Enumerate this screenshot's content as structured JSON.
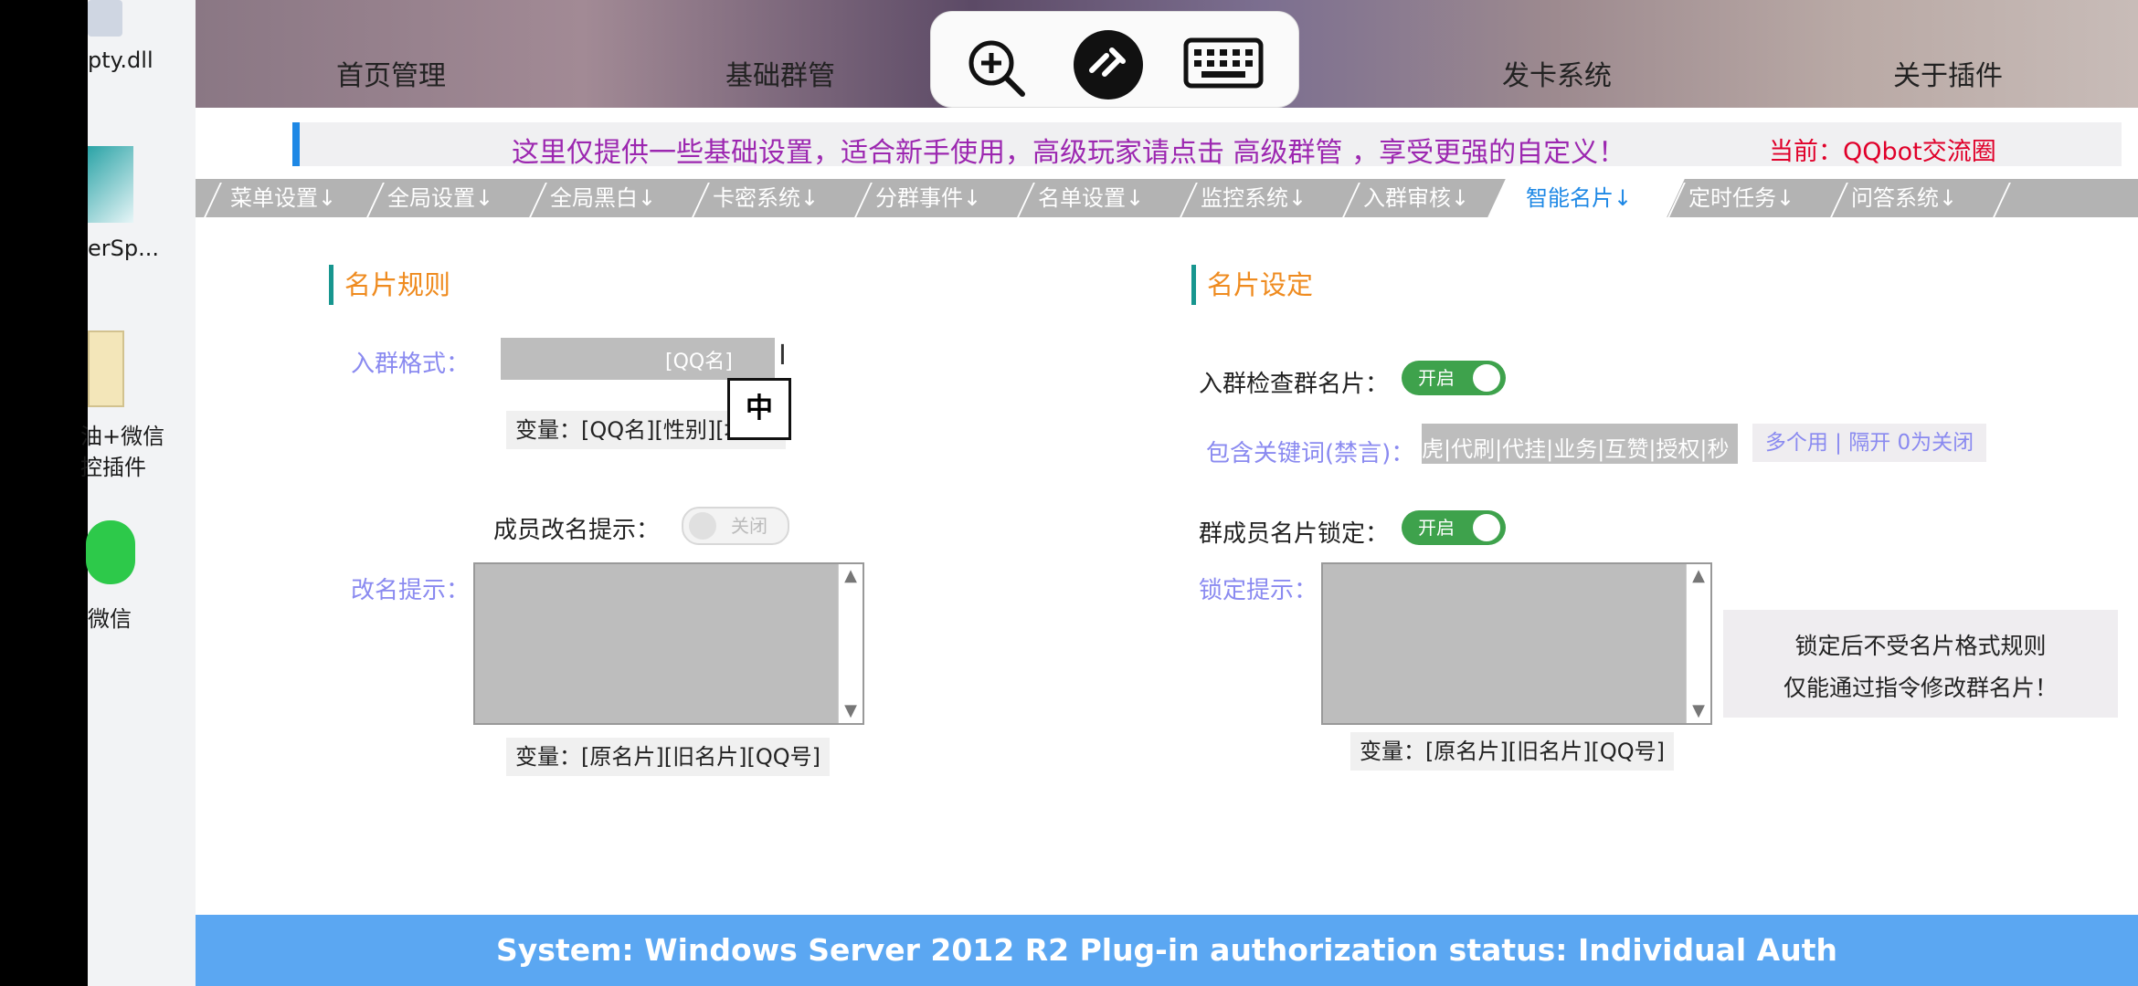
{
  "desktop": {
    "items": [
      "pty.dll",
      "erSp...",
      "油+微信",
      "控插件",
      "微信"
    ]
  },
  "nav": {
    "items": [
      "首页管理",
      "基础群管",
      "发卡系统",
      "关于插件"
    ]
  },
  "remote_toolbar": {
    "icons": [
      "zoom-in-icon",
      "remote-connect-icon",
      "keyboard-icon"
    ]
  },
  "notice": {
    "text": "这里仅提供一些基础设置，适合新手使用，高级玩家请点击 高级群管 ，享受更强的自定义！",
    "current_label": "当前：",
    "current_group": "QQbot交流圈"
  },
  "tabs": [
    {
      "label": "菜单设置↓",
      "active": false
    },
    {
      "label": "全局设置↓",
      "active": false
    },
    {
      "label": "全局黑白↓",
      "active": false
    },
    {
      "label": "卡密系统↓",
      "active": false
    },
    {
      "label": "分群事件↓",
      "active": false
    },
    {
      "label": "名单设置↓",
      "active": false
    },
    {
      "label": "监控系统↓",
      "active": false
    },
    {
      "label": "入群审核↓",
      "active": false
    },
    {
      "label": "智能名片↓",
      "active": true
    },
    {
      "label": "定时任务↓",
      "active": false
    },
    {
      "label": "问答系统↓",
      "active": false
    }
  ],
  "left": {
    "title": "名片规则",
    "join_format_label": "入群格式：",
    "join_format_value": "[QQ名]",
    "join_format_vars": "变量：[QQ名][性别][地区]",
    "rename_hint_label": "成员改名提示：",
    "rename_hint_state": "关闭",
    "rename_hint_text_label": "改名提示：",
    "rename_vars": "变量：[原名片][旧名片][QQ号]"
  },
  "right": {
    "title": "名片设定",
    "check_label": "入群检查群名片：",
    "check_state": "开启",
    "keywords_label": "包含关键词(禁言)：",
    "keywords_value": "虎|代刷|代挂|业务|互赞|授权|秒",
    "keywords_hint": "多个用 | 隔开 0为关闭",
    "lock_label": "群成员名片锁定：",
    "lock_state": "开启",
    "lock_hint_label": "锁定提示：",
    "lock_vars": "变量：[原名片][旧名片][QQ号]",
    "note_line1": "锁定后不受名片格式规则",
    "note_line2": "仅能通过指令修改群名片！"
  },
  "ime": {
    "char": "中"
  },
  "footer": {
    "text": "System:  Windows Server 2012 R2  Plug-in authorization status:  Individual Auth"
  },
  "colors": {
    "accent": "#1e88e5",
    "toggle_on": "#3ea24c",
    "section_title": "#ef8b1f",
    "footer": "#5ba7f2"
  }
}
